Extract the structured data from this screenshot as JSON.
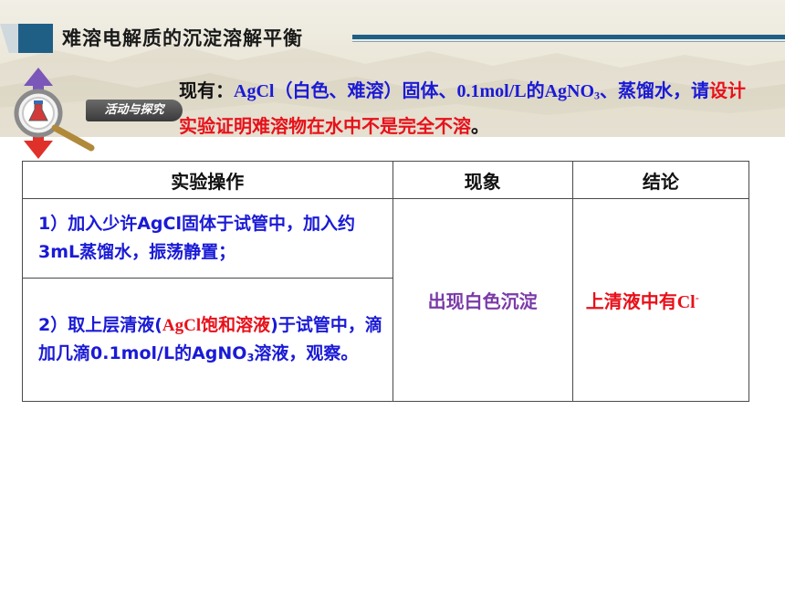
{
  "header": {
    "title": "难溶电解质的沉淀溶解平衡"
  },
  "badge": {
    "label": "活动与探究"
  },
  "intro": {
    "lead": "现有：",
    "agcl": "AgCl",
    "agcl_note": "（白色、难溶）固体、",
    "agno3_pre": "0.1mol/L的AgNO",
    "agno3_sub": "3",
    "sep": "、蒸馏水，请",
    "task": "设计实验证明难溶物在水中不是完全不溶",
    "end": "。"
  },
  "table": {
    "headers": [
      "实验操作",
      "现象",
      "结论"
    ],
    "step1": "1）加入少许AgCl固体于试管中，加入约3mL蒸馏水，振荡静置；",
    "step2_pre": "2）取上层清液(",
    "step2_red": "AgCl饱和溶液",
    "step2_mid": ")于试管中，滴加几滴0.1mol/L的AgNO",
    "step2_sub": "3",
    "step2_end": "溶液，观察。",
    "phenomenon": "出现白色沉淀",
    "conclusion_pre": "上清液中有",
    "conclusion_ion": "Cl",
    "conclusion_sup": "-"
  },
  "colors": {
    "accent": "#1f5f86",
    "text_blue": "#1a1ad6",
    "text_red": "#e8101a",
    "text_purple": "#7a3aa8"
  }
}
